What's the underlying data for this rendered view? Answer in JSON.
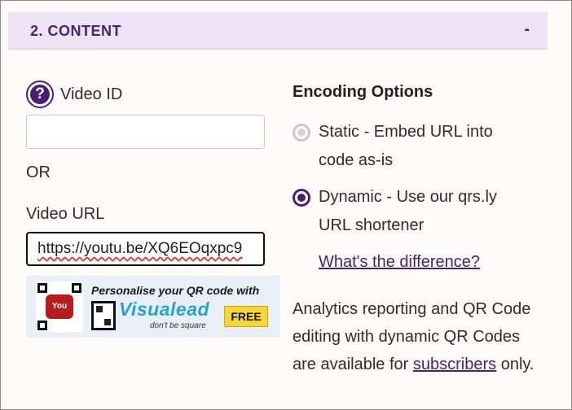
{
  "section": {
    "title": "2. CONTENT",
    "toggle": "-"
  },
  "video": {
    "help_icon": "?",
    "id_label": "Video ID",
    "id_value": "",
    "or_label": "OR",
    "url_label": "Video URL",
    "url_value": "https://youtu.be/XQ6EOqxpc9"
  },
  "promo": {
    "tagline": "Personalise your QR code with",
    "brand": "Visualead",
    "slogan": "don't be square",
    "badge": "FREE",
    "thumb_text": "You Tube"
  },
  "encoding": {
    "heading": "Encoding Options",
    "static_line1": "Static - Embed URL into",
    "static_line2": "code as-is",
    "dynamic_line1": "Dynamic - Use our qrs.ly",
    "dynamic_line2": "URL shortener",
    "difference_link": "What's the difference?",
    "selected": "dynamic"
  },
  "info": {
    "text_before": "Analytics reporting and QR Code editing with dynamic QR Codes are available for ",
    "subscribers_link": "subscribers",
    "text_after": " only."
  },
  "colors": {
    "accent": "#4a1f73",
    "header_bg": "#ece3f4",
    "brand_blue": "#2a9fd0",
    "badge_yellow": "#f7d63a"
  }
}
